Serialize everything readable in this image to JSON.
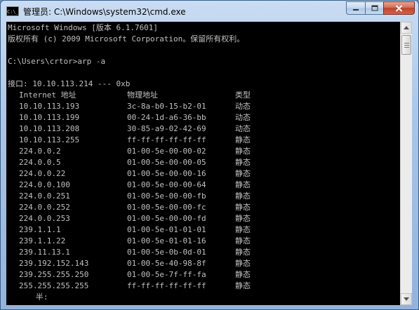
{
  "window": {
    "title": "管理员: C:\\Windows\\system32\\cmd.exe",
    "icon_text": "C:\\_"
  },
  "console": {
    "header": [
      "Microsoft Windows [版本 6.1.7601]",
      "版权所有 (c) 2009 Microsoft Corporation。保留所有权利。",
      "",
      "C:\\Users\\crtor>arp -a",
      "",
      "接口: 10.10.113.214 --- 0xb"
    ],
    "columns": [
      "Internet 地址",
      "物理地址",
      "类型"
    ],
    "rows": [
      [
        "10.10.113.193",
        "3c-8a-b0-15-b2-01",
        "动态"
      ],
      [
        "10.10.113.199",
        "00-24-1d-a6-36-bb",
        "动态"
      ],
      [
        "10.10.113.208",
        "30-85-a9-02-42-69",
        "动态"
      ],
      [
        "10.10.113.255",
        "ff-ff-ff-ff-ff-ff",
        "静态"
      ],
      [
        "224.0.0.2",
        "01-00-5e-00-00-02",
        "静态"
      ],
      [
        "224.0.0.5",
        "01-00-5e-00-00-05",
        "静态"
      ],
      [
        "224.0.0.22",
        "01-00-5e-00-00-16",
        "静态"
      ],
      [
        "224.0.0.100",
        "01-00-5e-00-00-64",
        "静态"
      ],
      [
        "224.0.0.251",
        "01-00-5e-00-00-fb",
        "静态"
      ],
      [
        "224.0.0.252",
        "01-00-5e-00-00-fc",
        "静态"
      ],
      [
        "224.0.0.253",
        "01-00-5e-00-00-fd",
        "静态"
      ],
      [
        "239.1.1.1",
        "01-00-5e-01-01-01",
        "静态"
      ],
      [
        "239.1.1.22",
        "01-00-5e-01-01-16",
        "静态"
      ],
      [
        "239.11.13.1",
        "01-00-5e-0b-0d-01",
        "静态"
      ],
      [
        "239.192.152.143",
        "01-00-5e-40-98-8f",
        "静态"
      ],
      [
        "239.255.255.250",
        "01-00-5e-7f-ff-fa",
        "静态"
      ],
      [
        "255.255.255.255",
        "ff-ff-ff-ff-ff-ff",
        "静态"
      ]
    ],
    "footer": "      半:"
  },
  "colors": {
    "console_bg": "#000000",
    "console_text": "#c0c0c0",
    "close_button": "#c0422a"
  },
  "icons": {
    "minimize": "minimize-icon",
    "maximize": "maximize-icon",
    "close": "close-icon"
  }
}
